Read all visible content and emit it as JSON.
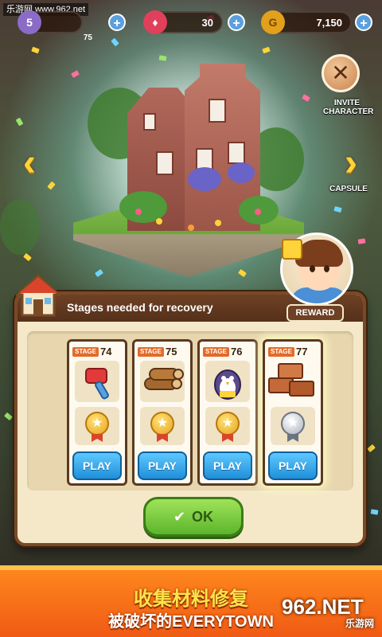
{
  "watermark": "乐游网 www.962.net",
  "topbar": {
    "level": "5",
    "energy_value": "30",
    "gem_value": "30",
    "coin_icon": "G",
    "coin_value": "7,150",
    "level_sub": "75"
  },
  "side": {
    "invite_label": "INVITE\nCHARACTER",
    "capsule_label": "CAPSULE",
    "close_icon_glyph": "✕"
  },
  "nav": {
    "left_glyph": "‹",
    "right_glyph": "›"
  },
  "panel": {
    "title": "Stages needed for recovery",
    "reward_label": "REWARD",
    "ok_label": "OK",
    "stages": [
      {
        "label": "STAGE",
        "number": "74",
        "item": "hammer-icon",
        "medal": "gold",
        "play_label": "PLAY"
      },
      {
        "label": "STAGE",
        "number": "75",
        "item": "logs-icon",
        "medal": "gold",
        "play_label": "PLAY"
      },
      {
        "label": "STAGE",
        "number": "76",
        "item": "penguin-icon",
        "medal": "gold",
        "play_label": "PLAY"
      },
      {
        "label": "STAGE",
        "number": "77",
        "item": "bricks-icon",
        "medal": "silver",
        "play_label": "PLAY"
      }
    ]
  },
  "banner": {
    "line1": "收集材料修复",
    "line2": "被破坏的EVERYTOWN"
  },
  "site_logo": {
    "main": "962.NET",
    "sub": "乐游网"
  },
  "colors": {
    "accent_orange": "#f05a14",
    "play_blue": "#1f8fd8",
    "ok_green": "#5cb52b",
    "panel_brown": "#6e4125"
  }
}
